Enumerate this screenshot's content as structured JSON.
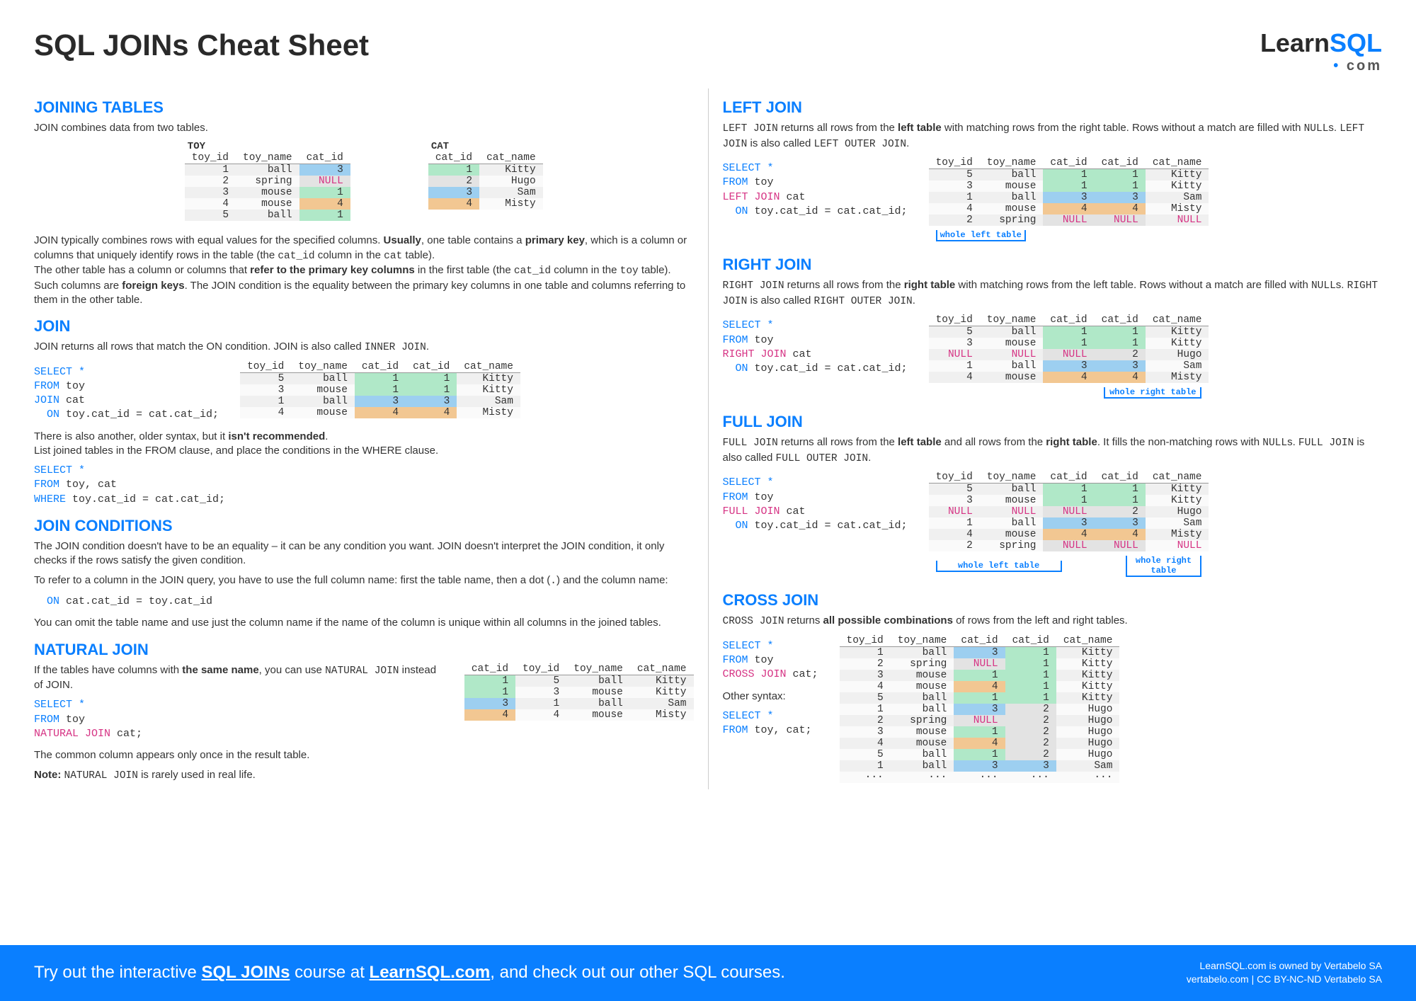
{
  "title": "SQL JOINs Cheat Sheet",
  "brand": {
    "learn": "Learn",
    "sql": "SQL",
    "dotcom": "com"
  },
  "left": {
    "joining_tables": {
      "heading": "JOINING TABLES",
      "intro": "JOIN combines data from two tables.",
      "toy_label": "TOY",
      "cat_label": "CAT",
      "toy_headers": [
        "toy_id",
        "toy_name",
        "cat_id"
      ],
      "toy_rows": [
        [
          1,
          "ball",
          3
        ],
        [
          2,
          "spring",
          "NULL"
        ],
        [
          3,
          "mouse",
          1
        ],
        [
          4,
          "mouse",
          4
        ],
        [
          5,
          "ball",
          1
        ]
      ],
      "cat_headers": [
        "cat_id",
        "cat_name"
      ],
      "cat_rows": [
        [
          1,
          "Kitty"
        ],
        [
          2,
          "Hugo"
        ],
        [
          3,
          "Sam"
        ],
        [
          4,
          "Misty"
        ]
      ],
      "para1_a": "JOIN typically combines rows with equal values for the specified columns. ",
      "para1_b": "Usually",
      "para1_c": ", one table contains a ",
      "para1_d": "primary key",
      "para1_e": ", which is a column or columns that uniquely identify rows in the table (the ",
      "para1_f": "cat_id",
      "para1_g": " column in the ",
      "para1_h": "cat",
      "para1_i": " table).",
      "para2_a": "The other table has a column or columns that ",
      "para2_b": "refer to the primary key columns",
      "para2_c": " in the first table (the ",
      "para2_d": "cat_id",
      "para2_e": " column in the ",
      "para2_f": "toy",
      "para2_g": " table). Such columns are ",
      "para2_h": "foreign keys",
      "para2_i": ". The JOIN condition is the equality between the primary key columns in one table and columns referring to them in the other table."
    },
    "join": {
      "heading": "JOIN",
      "desc_a": "JOIN returns all rows that match the ON condition. JOIN is also called ",
      "desc_b": "INNER JOIN",
      "desc_c": ".",
      "sql1_l1": "SELECT *",
      "sql1_l2_a": "FROM",
      "sql1_l2_b": " toy",
      "sql1_l3_a": "JOIN",
      "sql1_l3_b": " cat",
      "sql1_l4_a": "  ON",
      "sql1_l4_b": " toy.cat_id = cat.cat_id;",
      "headers": [
        "toy_id",
        "toy_name",
        "cat_id",
        "cat_id",
        "cat_name"
      ],
      "rows": [
        [
          5,
          "ball",
          1,
          1,
          "Kitty"
        ],
        [
          3,
          "mouse",
          1,
          1,
          "Kitty"
        ],
        [
          1,
          "ball",
          3,
          3,
          "Sam"
        ],
        [
          4,
          "mouse",
          4,
          4,
          "Misty"
        ]
      ],
      "note_a": "There is also another, older syntax, but it ",
      "note_b": "isn't recommended",
      "note_c": ".",
      "note2": "List joined tables in the FROM clause, and place the conditions in the WHERE clause.",
      "sql2_l1": "SELECT *",
      "sql2_l2_a": "FROM",
      "sql2_l2_b": " toy, cat",
      "sql2_l3_a": "WHERE",
      "sql2_l3_b": " toy.cat_id = cat.cat_id;"
    },
    "conditions": {
      "heading": "JOIN CONDITIONS",
      "p1": "The JOIN condition doesn't have to be an equality – it can be any condition you want. JOIN doesn't interpret the JOIN condition, it only checks if the rows satisfy the given condition.",
      "p2_a": "To refer to a column in the JOIN query, you have to use the full column name: first the table name, then a dot (",
      "p2_b": ".",
      "p2_c": ") and the column name:",
      "cond_a": "  ON",
      "cond_b": " cat.cat_id = toy.cat_id",
      "p3": "You can omit the table name and use just the column name if the name of the column is unique within all columns in the joined tables."
    },
    "natural": {
      "heading": "NATURAL JOIN",
      "p1_a": "If the tables have columns with ",
      "p1_b": "the same name",
      "p1_c": ", you can use ",
      "p1_d": "NATURAL JOIN",
      "p1_e": " instead of JOIN.",
      "sql_l1": "SELECT *",
      "sql_l2_a": "FROM",
      "sql_l2_b": " toy",
      "sql_l3_a": "NATURAL JOIN",
      "sql_l3_b": " cat;",
      "headers": [
        "cat_id",
        "toy_id",
        "toy_name",
        "cat_name"
      ],
      "rows": [
        [
          1,
          5,
          "ball",
          "Kitty"
        ],
        [
          1,
          3,
          "mouse",
          "Kitty"
        ],
        [
          3,
          1,
          "ball",
          "Sam"
        ],
        [
          4,
          4,
          "mouse",
          "Misty"
        ]
      ],
      "p2": "The common column appears only once in the result table.",
      "p3_a": "Note:  ",
      "p3_b": "NATURAL JOIN",
      "p3_c": " is rarely used in real life."
    }
  },
  "right": {
    "leftjoin": {
      "heading": "LEFT JOIN",
      "desc_a": "LEFT JOIN",
      "desc_b": " returns all rows from the ",
      "desc_c": "left table",
      "desc_d": " with matching rows from the right table. Rows without a match are filled with ",
      "desc_e": "NULL",
      "desc_f": "s. ",
      "desc_g": "LEFT JOIN",
      "desc_h": " is also called ",
      "desc_i": "LEFT OUTER JOIN",
      "desc_j": ".",
      "sql_l1": "SELECT *",
      "sql_l2_a": "FROM",
      "sql_l2_b": " toy",
      "sql_l3_a": "LEFT JOIN",
      "sql_l3_b": " cat",
      "sql_l4_a": "  ON",
      "sql_l4_b": " toy.cat_id = cat.cat_id;",
      "headers": [
        "toy_id",
        "toy_name",
        "cat_id",
        "cat_id",
        "cat_name"
      ],
      "rows": [
        [
          5,
          "ball",
          1,
          1,
          "Kitty"
        ],
        [
          3,
          "mouse",
          1,
          1,
          "Kitty"
        ],
        [
          1,
          "ball",
          3,
          3,
          "Sam"
        ],
        [
          4,
          "mouse",
          4,
          4,
          "Misty"
        ],
        [
          2,
          "spring",
          "NULL",
          "NULL",
          "NULL"
        ]
      ],
      "bracket": "whole left table"
    },
    "rightjoin": {
      "heading": "RIGHT JOIN",
      "desc_a": "RIGHT JOIN",
      "desc_b": " returns all rows from the ",
      "desc_c": "right table",
      "desc_d": " with matching rows from the left table. Rows without a match are filled with ",
      "desc_e": "NULL",
      "desc_f": "s. ",
      "desc_g": "RIGHT JOIN",
      "desc_h": " is also called ",
      "desc_i": "RIGHT OUTER JOIN",
      "desc_j": ".",
      "sql_l1": "SELECT *",
      "sql_l2_a": "FROM",
      "sql_l2_b": " toy",
      "sql_l3_a": "RIGHT JOIN",
      "sql_l3_b": " cat",
      "sql_l4_a": "  ON",
      "sql_l4_b": " toy.cat_id = cat.cat_id;",
      "headers": [
        "toy_id",
        "toy_name",
        "cat_id",
        "cat_id",
        "cat_name"
      ],
      "rows": [
        [
          5,
          "ball",
          1,
          1,
          "Kitty"
        ],
        [
          3,
          "mouse",
          1,
          1,
          "Kitty"
        ],
        [
          "NULL",
          "NULL",
          "NULL",
          2,
          "Hugo"
        ],
        [
          1,
          "ball",
          3,
          3,
          "Sam"
        ],
        [
          4,
          "mouse",
          4,
          4,
          "Misty"
        ]
      ],
      "bracket": "whole right table"
    },
    "fulljoin": {
      "heading": "FULL JOIN",
      "desc_a": "FULL JOIN",
      "desc_b": " returns all rows from the ",
      "desc_c": "left table",
      "desc_d": " and all rows from the ",
      "desc_e": "right table",
      "desc_f": ". It fills the non-matching rows with ",
      "desc_g": "NULL",
      "desc_h": "s. ",
      "desc_i": "FULL JOIN",
      "desc_j": " is also called ",
      "desc_k": "FULL OUTER JOIN",
      "desc_l": ".",
      "sql_l1": "SELECT *",
      "sql_l2_a": "FROM",
      "sql_l2_b": " toy",
      "sql_l3_a": "FULL JOIN",
      "sql_l3_b": " cat",
      "sql_l4_a": "  ON",
      "sql_l4_b": " toy.cat_id = cat.cat_id;",
      "headers": [
        "toy_id",
        "toy_name",
        "cat_id",
        "cat_id",
        "cat_name"
      ],
      "rows": [
        [
          5,
          "ball",
          1,
          1,
          "Kitty"
        ],
        [
          3,
          "mouse",
          1,
          1,
          "Kitty"
        ],
        [
          "NULL",
          "NULL",
          "NULL",
          2,
          "Hugo"
        ],
        [
          1,
          "ball",
          3,
          3,
          "Sam"
        ],
        [
          4,
          "mouse",
          4,
          4,
          "Misty"
        ],
        [
          2,
          "spring",
          "NULL",
          "NULL",
          "NULL"
        ]
      ],
      "bracket_l": "whole left table",
      "bracket_r": "whole right table"
    },
    "crossjoin": {
      "heading": "CROSS JOIN",
      "desc_a": "CROSS JOIN",
      "desc_b": " returns ",
      "desc_c": "all possible combinations",
      "desc_d": " of rows from the left and right tables.",
      "sql_l1": "SELECT *",
      "sql_l2_a": "FROM",
      "sql_l2_b": " toy",
      "sql_l3_a": "CROSS JOIN",
      "sql_l3_b": " cat;",
      "other": "Other syntax:",
      "sql2_l1": "SELECT *",
      "sql2_l2_a": "FROM",
      "sql2_l2_b": " toy, cat;",
      "headers": [
        "toy_id",
        "toy_name",
        "cat_id",
        "cat_id",
        "cat_name"
      ],
      "rows": [
        [
          1,
          "ball",
          3,
          1,
          "Kitty"
        ],
        [
          2,
          "spring",
          "NULL",
          1,
          "Kitty"
        ],
        [
          3,
          "mouse",
          1,
          1,
          "Kitty"
        ],
        [
          4,
          "mouse",
          4,
          1,
          "Kitty"
        ],
        [
          5,
          "ball",
          1,
          1,
          "Kitty"
        ],
        [
          1,
          "ball",
          3,
          2,
          "Hugo"
        ],
        [
          2,
          "spring",
          "NULL",
          2,
          "Hugo"
        ],
        [
          3,
          "mouse",
          1,
          2,
          "Hugo"
        ],
        [
          4,
          "mouse",
          4,
          2,
          "Hugo"
        ],
        [
          5,
          "ball",
          1,
          2,
          "Hugo"
        ],
        [
          1,
          "ball",
          3,
          3,
          "Sam"
        ],
        [
          "···",
          "···",
          "···",
          "···",
          "···"
        ]
      ]
    }
  },
  "footer": {
    "cta_a": "Try out the interactive ",
    "cta_b": "SQL JOINs",
    "cta_c": " course at ",
    "cta_d": "LearnSQL.com",
    "cta_e": ", and check out our other SQL courses.",
    "legal1": "LearnSQL.com is owned by Vertabelo SA",
    "legal2": "vertabelo.com | CC BY-NC-ND Vertabelo SA"
  },
  "chart_data": {
    "type": "table",
    "source_tables": {
      "toy": {
        "columns": [
          "toy_id",
          "toy_name",
          "cat_id"
        ],
        "rows": [
          [
            1,
            "ball",
            3
          ],
          [
            2,
            "spring",
            null
          ],
          [
            3,
            "mouse",
            1
          ],
          [
            4,
            "mouse",
            4
          ],
          [
            5,
            "ball",
            1
          ]
        ]
      },
      "cat": {
        "columns": [
          "cat_id",
          "cat_name"
        ],
        "rows": [
          [
            1,
            "Kitty"
          ],
          [
            2,
            "Hugo"
          ],
          [
            3,
            "Sam"
          ],
          [
            4,
            "Misty"
          ]
        ]
      }
    },
    "joins": {
      "inner": [
        [
          5,
          "ball",
          1,
          1,
          "Kitty"
        ],
        [
          3,
          "mouse",
          1,
          1,
          "Kitty"
        ],
        [
          1,
          "ball",
          3,
          3,
          "Sam"
        ],
        [
          4,
          "mouse",
          4,
          4,
          "Misty"
        ]
      ],
      "left": [
        [
          5,
          "ball",
          1,
          1,
          "Kitty"
        ],
        [
          3,
          "mouse",
          1,
          1,
          "Kitty"
        ],
        [
          1,
          "ball",
          3,
          3,
          "Sam"
        ],
        [
          4,
          "mouse",
          4,
          4,
          "Misty"
        ],
        [
          2,
          "spring",
          null,
          null,
          null
        ]
      ],
      "right": [
        [
          5,
          "ball",
          1,
          1,
          "Kitty"
        ],
        [
          3,
          "mouse",
          1,
          1,
          "Kitty"
        ],
        [
          null,
          null,
          null,
          2,
          "Hugo"
        ],
        [
          1,
          "ball",
          3,
          3,
          "Sam"
        ],
        [
          4,
          "mouse",
          4,
          4,
          "Misty"
        ]
      ],
      "full": [
        [
          5,
          "ball",
          1,
          1,
          "Kitty"
        ],
        [
          3,
          "mouse",
          1,
          1,
          "Kitty"
        ],
        [
          null,
          null,
          null,
          2,
          "Hugo"
        ],
        [
          1,
          "ball",
          3,
          3,
          "Sam"
        ],
        [
          4,
          "mouse",
          4,
          4,
          "Misty"
        ],
        [
          2,
          "spring",
          null,
          null,
          null
        ]
      ],
      "natural": [
        [
          1,
          5,
          "ball",
          "Kitty"
        ],
        [
          1,
          3,
          "mouse",
          "Kitty"
        ],
        [
          3,
          1,
          "ball",
          "Sam"
        ],
        [
          4,
          4,
          "mouse",
          "Misty"
        ]
      ]
    }
  }
}
